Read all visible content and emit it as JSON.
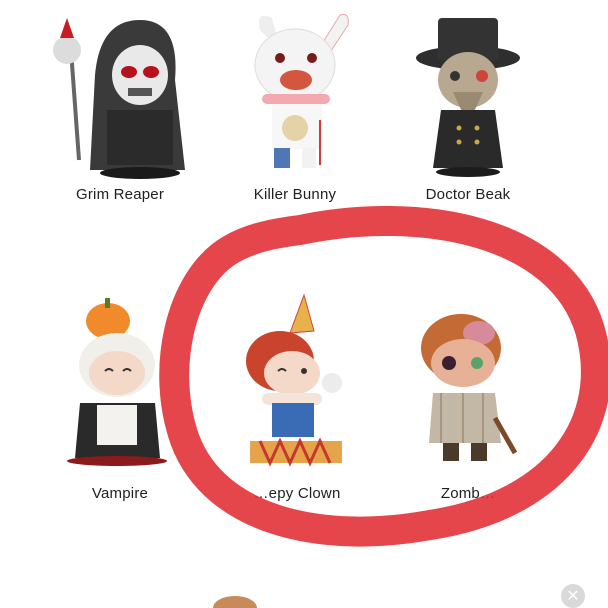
{
  "products": [
    {
      "name": "Grim Reaper",
      "icon": "grim-reaper-figure"
    },
    {
      "name": "Killer Bunny",
      "icon": "killer-bunny-figure"
    },
    {
      "name": "Doctor Beak",
      "icon": "doctor-beak-figure"
    },
    {
      "name": "Vampire",
      "icon": "vampire-figure"
    },
    {
      "name": "…epy Clown",
      "icon": "sleepy-clown-figure"
    },
    {
      "name": "Zomb…",
      "icon": "zombie-figure"
    }
  ],
  "annotation": {
    "color": "#e0262d"
  },
  "close_icon": "close-icon"
}
